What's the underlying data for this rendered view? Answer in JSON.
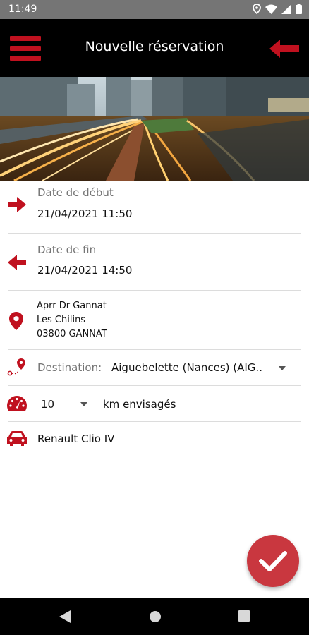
{
  "status_bar": {
    "time": "11:49"
  },
  "app_bar": {
    "title": "Nouvelle réservation"
  },
  "form": {
    "start": {
      "label": "Date de début",
      "value": "21/04/2021 11:50"
    },
    "end": {
      "label": "Date de fin",
      "value": "21/04/2021 14:50"
    },
    "address": {
      "line1": "Aprr Dr Gannat",
      "line2": "Les Chilins",
      "line3": "03800 GANNAT"
    },
    "destination": {
      "label": "Destination:",
      "value": "Aiguebelette (Nances) (AIG.."
    },
    "distance": {
      "value": "10",
      "unit": "km envisagés"
    },
    "vehicle": {
      "value": "Renault Clio IV"
    }
  },
  "colors": {
    "accent": "#c0111f",
    "fab": "#c9373f",
    "appbar": "#000000",
    "statusbar": "#757575"
  },
  "icons": [
    "menu-icon",
    "back-arrow-icon",
    "arrow-right-icon",
    "arrow-left-icon",
    "location-pin-icon",
    "route-destination-icon",
    "speedometer-icon",
    "car-icon",
    "check-icon"
  ]
}
